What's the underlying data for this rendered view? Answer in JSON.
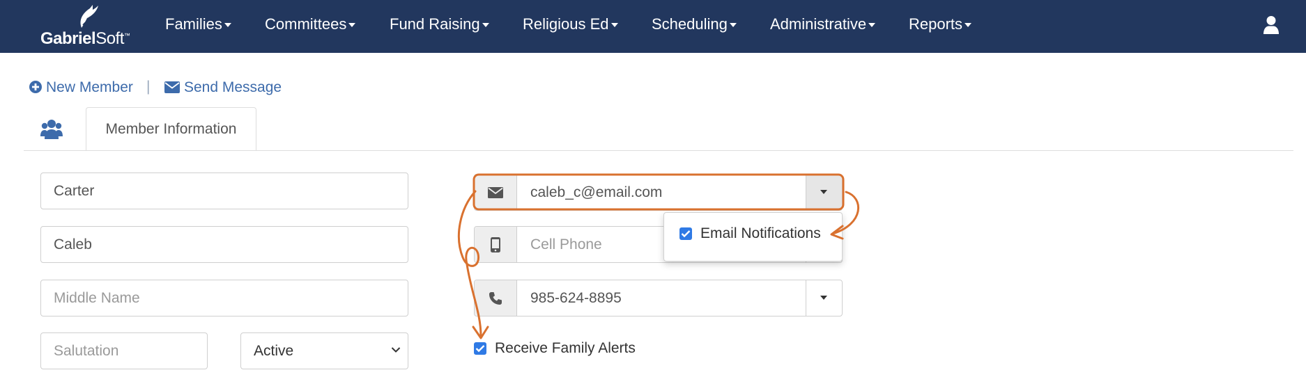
{
  "brand": {
    "name_bold": "Gabriel",
    "name_light": "Soft",
    "trademark": "™"
  },
  "nav": {
    "items": [
      {
        "label": "Families"
      },
      {
        "label": "Committees"
      },
      {
        "label": "Fund Raising"
      },
      {
        "label": "Religious Ed"
      },
      {
        "label": "Scheduling"
      },
      {
        "label": "Administrative"
      },
      {
        "label": "Reports"
      }
    ],
    "user_icon": "user-icon"
  },
  "actions": {
    "new_member": "New Member",
    "separator": "|",
    "send_message": "Send Message"
  },
  "tabs": {
    "group_icon": "users-icon",
    "active_label": "Member Information"
  },
  "form": {
    "last_name": {
      "value": "Carter"
    },
    "first_name": {
      "value": "Caleb"
    },
    "middle_name": {
      "placeholder": "Middle Name"
    },
    "salutation": {
      "placeholder": "Salutation"
    },
    "status": {
      "selected": "Active"
    },
    "email": {
      "value": "caleb_c@email.com",
      "icon": "envelope-icon"
    },
    "cell_phone": {
      "placeholder": "Cell Phone",
      "icon": "mobile-icon"
    },
    "phone": {
      "value": "985-624-8895",
      "icon": "phone-icon"
    },
    "receive_family_alerts": {
      "label": "Receive Family Alerts",
      "checked": true
    }
  },
  "email_menu": {
    "items": [
      {
        "label": "Email Notifications",
        "checked": true
      }
    ]
  },
  "colors": {
    "navbar": "#22375e",
    "link": "#3d6bab",
    "annotation": "#d9712f",
    "checkbox": "#2f7ae5"
  }
}
